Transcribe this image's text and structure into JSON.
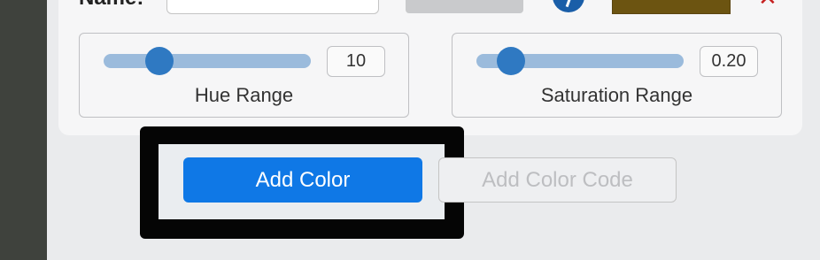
{
  "header": {
    "name_label": "Name:"
  },
  "colors": {
    "swatch": "#6c5411",
    "accent": "#0f78e6",
    "close": "#c62020"
  },
  "hue_range": {
    "label": "Hue Range",
    "value": "10"
  },
  "saturation_range": {
    "label": "Saturation Range",
    "value": "0.20"
  },
  "actions": {
    "add_color": "Add Color",
    "add_color_code": "Add Color Code"
  }
}
